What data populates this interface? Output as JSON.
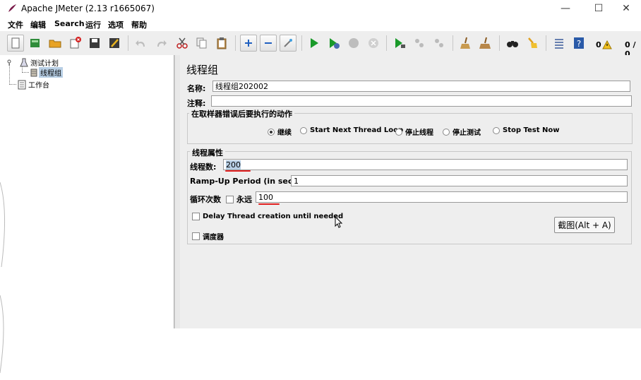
{
  "window": {
    "title": "Apache JMeter (2.13 r1665067)",
    "minimize": "—",
    "maximize": "☐",
    "close": "✕"
  },
  "menu": [
    "文件",
    "编辑",
    "Search",
    "运行",
    "选项",
    "帮助"
  ],
  "toolbar": {
    "error_count": "0",
    "thread_count": "0 / 0"
  },
  "tree": {
    "root": "测试计划",
    "child": "线程组",
    "workbench": "工作台"
  },
  "panel": {
    "title": "线程组",
    "name_label": "名称:",
    "name_value": "线程组202002",
    "comment_label": "注释:",
    "comment_value": "",
    "error_group_title": "在取样器错误后要执行的动作",
    "error_actions": [
      "继续",
      "Start Next Thread Loop",
      "停止线程",
      "停止测试",
      "Stop Test Now"
    ],
    "error_selected": "继续",
    "thread_group_title": "线程属性",
    "threads_label": "线程数:",
    "threads_value": "200",
    "rampup_label": "Ramp-Up Period (in seconds):",
    "rampup_value": "1",
    "loop_label": "循环次数",
    "forever_label": "永远",
    "loop_value": "100",
    "delay_label": "Delay Thread creation until needed",
    "scheduler_label": "调度器"
  },
  "overlay": {
    "screenshot_button": "截图(Alt + A)"
  },
  "colors": {
    "annotation_red": "#e02020",
    "selection": "#b8cfe5",
    "panel_bg": "#eeeeee"
  }
}
